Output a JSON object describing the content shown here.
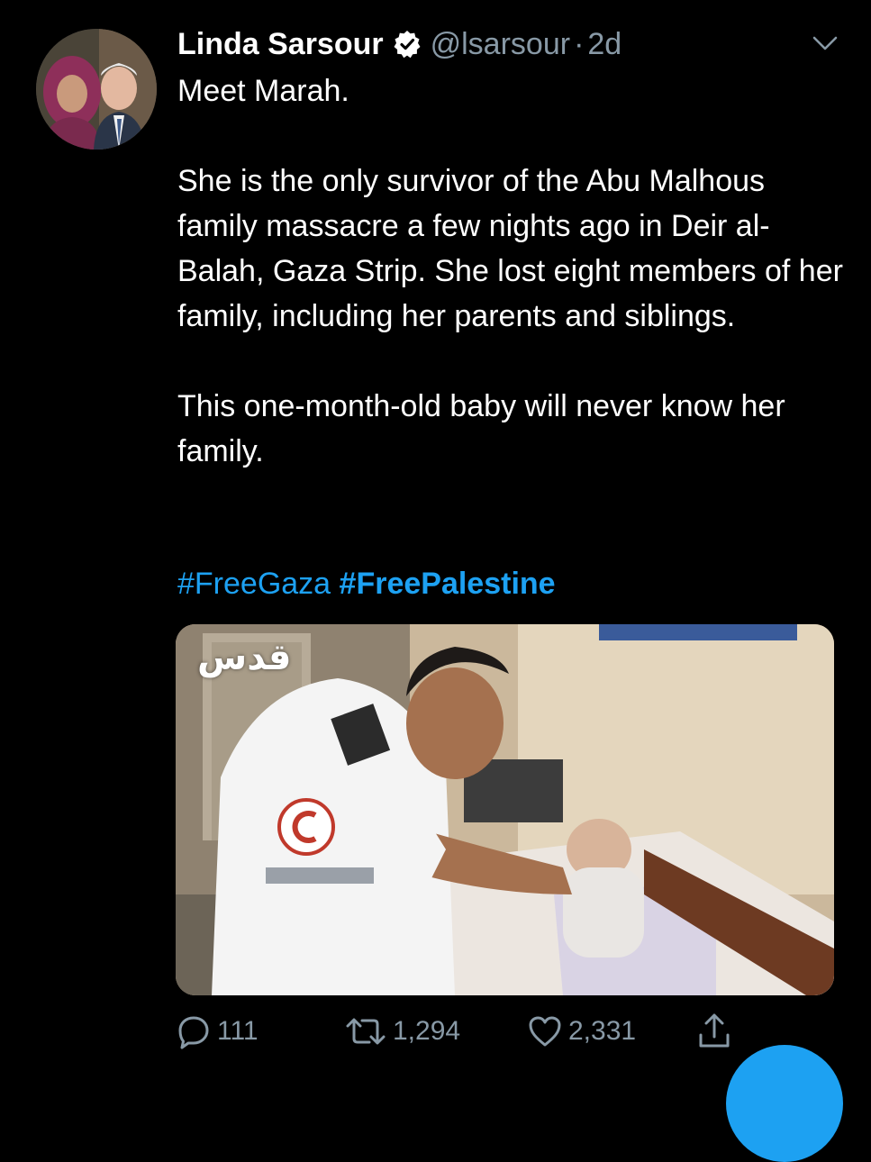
{
  "tweet": {
    "author_name": "Linda Sarsour",
    "handle": "@lsarsour",
    "separator": "·",
    "timestamp": "2d",
    "paragraphs": [
      "Meet Marah.",
      "She is the only survivor of the Abu Malhous family massacre a few nights ago in Deir al-Balah, Gaza Strip. She lost eight members of her family, including her parents and siblings.",
      "This one-month-old baby will never know her family."
    ],
    "hashtags": [
      "#FreeGaza",
      "#FreePalestine"
    ],
    "media": {
      "watermark": "قدس"
    }
  },
  "actions": {
    "reply_count": "111",
    "retweet_count": "1,294",
    "like_count": "2,331"
  },
  "icons": {
    "verified": "verified-badge-icon",
    "caret": "chevron-down-icon",
    "reply": "reply-icon",
    "retweet": "retweet-icon",
    "like": "heart-icon",
    "share": "share-icon"
  },
  "colors": {
    "background": "#000000",
    "text": "#ffffff",
    "secondary": "#8899a6",
    "link": "#1da1f2"
  }
}
